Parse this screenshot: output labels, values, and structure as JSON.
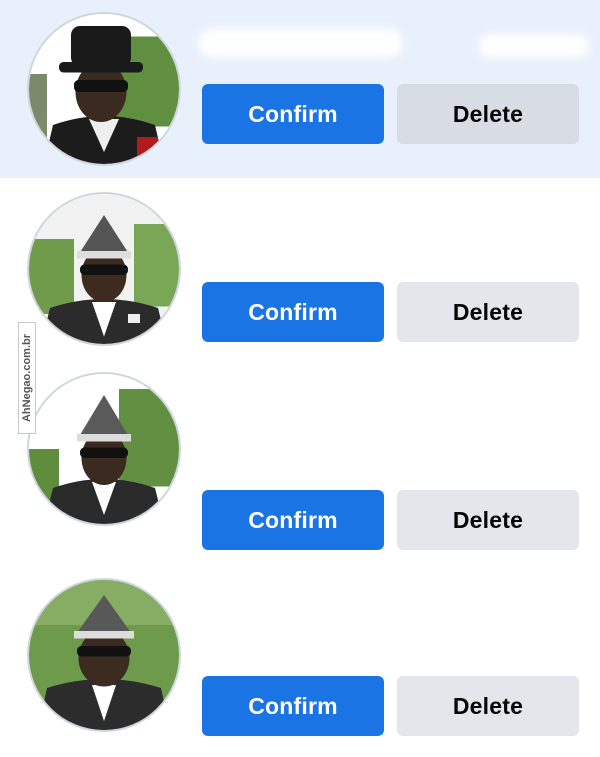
{
  "requests": [
    {
      "confirm_label": "Confirm",
      "delete_label": "Delete",
      "highlighted": true
    },
    {
      "confirm_label": "Confirm",
      "delete_label": "Delete",
      "highlighted": false
    },
    {
      "confirm_label": "Confirm",
      "delete_label": "Delete",
      "highlighted": false
    },
    {
      "confirm_label": "Confirm",
      "delete_label": "Delete",
      "highlighted": false
    }
  ],
  "watermark": {
    "text": "AhNegao.com.br"
  },
  "colors": {
    "confirm_bg": "#1b74e4",
    "delete_bg": "#e4e6eb",
    "highlight_row_bg": "#e8f0fb"
  }
}
